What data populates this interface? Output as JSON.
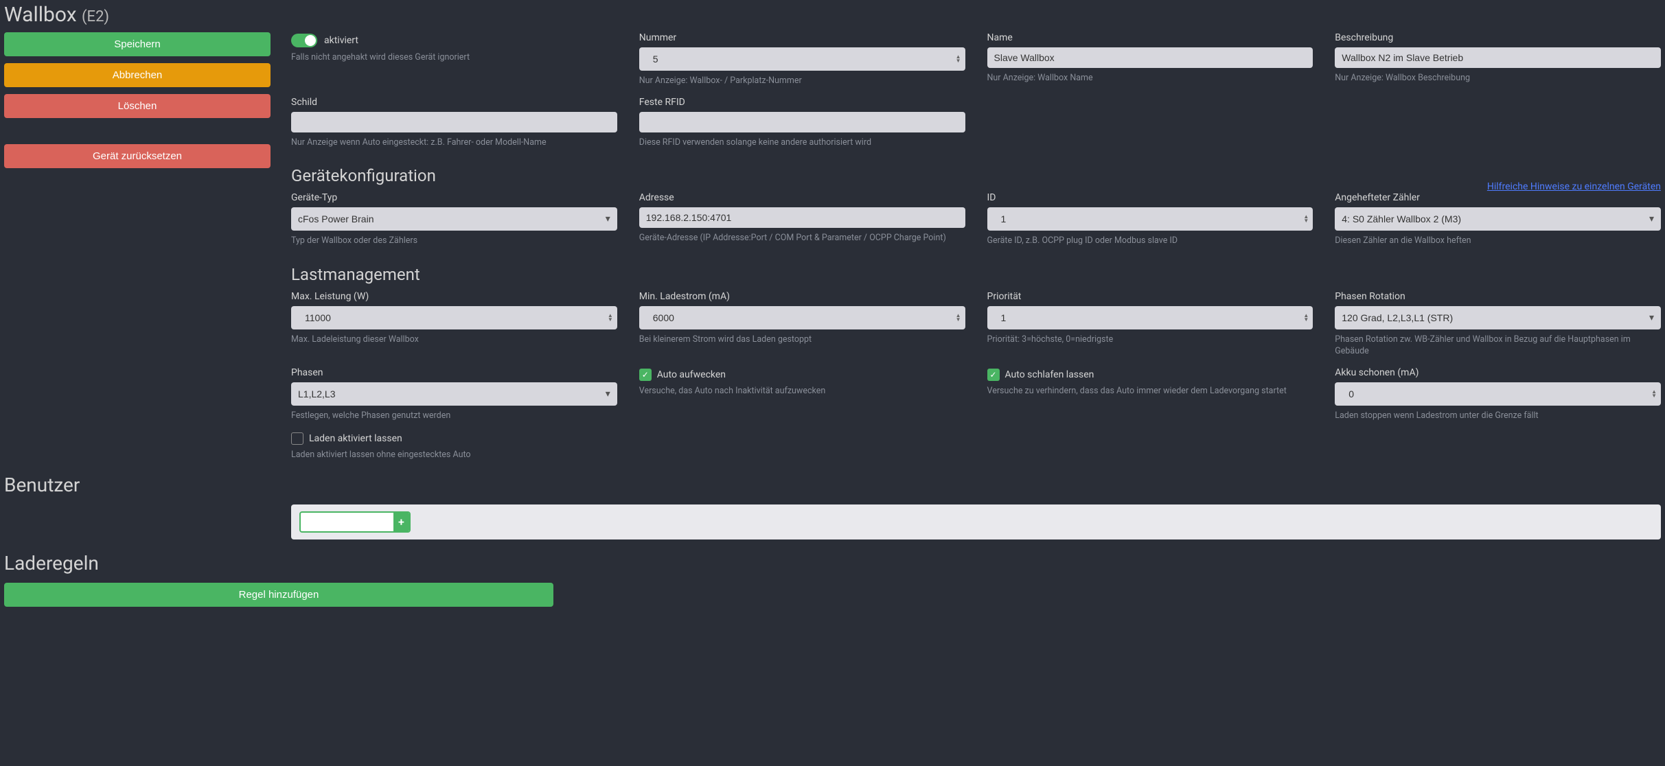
{
  "title_main": "Wallbox",
  "title_sub": "(E2)",
  "buttons": {
    "save": "Speichern",
    "cancel": "Abbrechen",
    "delete": "Löschen",
    "reset": "Gerät zurücksetzen",
    "add_rule": "Regel hinzufügen"
  },
  "activated": {
    "label": "aktiviert",
    "help": "Falls nicht angehakt wird dieses Gerät ignoriert"
  },
  "number": {
    "label": "Nummer",
    "value": "5",
    "help": "Nur Anzeige: Wallbox- / Parkplatz-Nummer"
  },
  "name": {
    "label": "Name",
    "value": "Slave Wallbox",
    "help": "Nur Anzeige: Wallbox Name"
  },
  "desc": {
    "label": "Beschreibung",
    "value": "Wallbox N2 im Slave Betrieb",
    "help": "Nur Anzeige: Wallbox Beschreibung"
  },
  "schild": {
    "label": "Schild",
    "value": "",
    "help": "Nur Anzeige wenn Auto eingesteckt: z.B. Fahrer- oder Modell-Name"
  },
  "rfid": {
    "label": "Feste RFID",
    "value": "",
    "help": "Diese RFID verwenden solange keine andere authorisiert wird"
  },
  "section_device": "Gerätekonfiguration",
  "device_hint_link": "Hilfreiche Hinweise zu einzelnen Geräten",
  "type": {
    "label": "Geräte-Typ",
    "value": "cFos Power Brain",
    "help": "Typ der Wallbox oder des Zählers"
  },
  "address": {
    "label": "Adresse",
    "value": "192.168.2.150:4701",
    "help": "Geräte-Adresse (IP Addresse:Port / COM Port & Parameter / OCPP Charge Point)"
  },
  "id": {
    "label": "ID",
    "value": "1",
    "help": "Geräte ID, z.B. OCPP plug ID oder Modbus slave ID"
  },
  "meter": {
    "label": "Angehefteter Zähler",
    "value": "4: S0 Zähler Wallbox 2 (M3)",
    "help": "Diesen Zähler an die Wallbox heften"
  },
  "section_load": "Lastmanagement",
  "maxpower": {
    "label": "Max. Leistung (W)",
    "value": "11000",
    "help": "Max. Ladeleistung dieser Wallbox"
  },
  "mincur": {
    "label": "Min. Ladestrom (mA)",
    "value": "6000",
    "help": "Bei kleinerem Strom wird das Laden gestoppt"
  },
  "prio": {
    "label": "Priorität",
    "value": "1",
    "help": "Priorität: 3=höchste, 0=niedrigste"
  },
  "rot": {
    "label": "Phasen Rotation",
    "value": "120 Grad, L2,L3,L1 (STR)",
    "help": "Phasen Rotation zw. WB-Zähler und Wallbox in Bezug auf die Hauptphasen im Gebäude"
  },
  "phases": {
    "label": "Phasen",
    "value": "L1,L2,L3",
    "help": "Festlegen, welche Phasen genutzt werden"
  },
  "wake": {
    "label": "Auto aufwecken",
    "help": "Versuche, das Auto nach Inaktivität aufzuwecken"
  },
  "sleep": {
    "label": "Auto schlafen lassen",
    "help": "Versuche zu verhindern, dass das Auto immer wieder dem Ladevorgang startet"
  },
  "akku": {
    "label": "Akku schonen (mA)",
    "value": "0",
    "help": "Laden stoppen wenn Ladestrom unter die Grenze fällt"
  },
  "keep": {
    "label": "Laden aktiviert lassen",
    "help": "Laden aktiviert lassen ohne eingestecktes Auto"
  },
  "section_user": "Benutzer",
  "section_rules": "Laderegeln",
  "plus": "+"
}
